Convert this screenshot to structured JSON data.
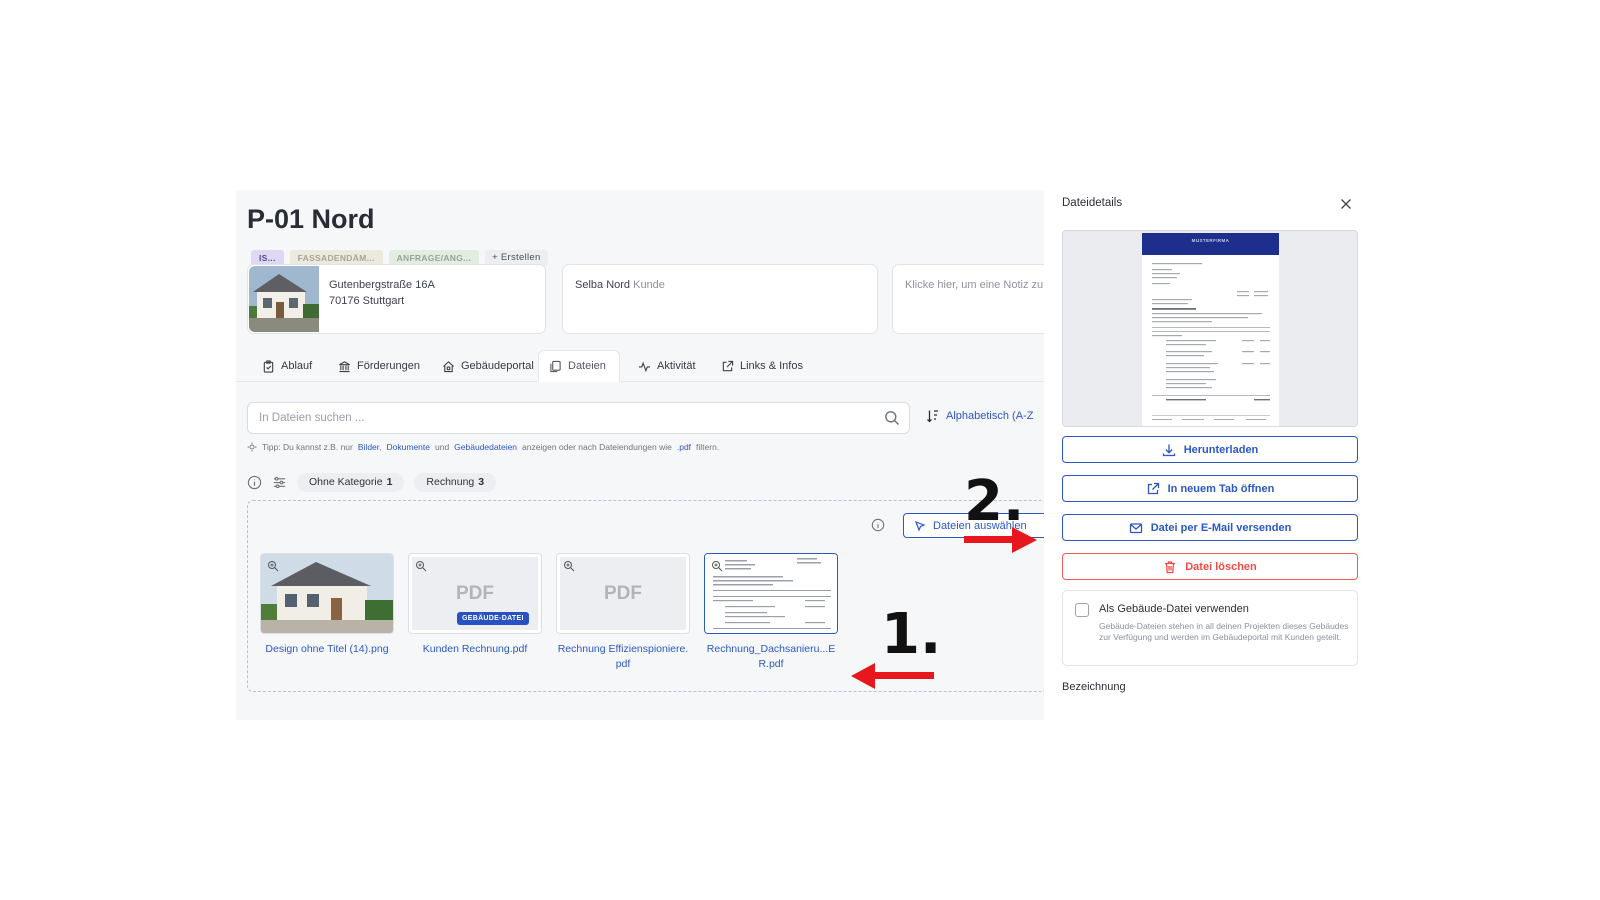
{
  "project": {
    "title": "P-01 Nord",
    "tags": [
      "IS...",
      "FASSADENDÄM...",
      "ANFRAGE/ANG...",
      "+ Erstellen"
    ],
    "address_line1": "Gutenbergstraße 16A",
    "address_line2": "70176 Stuttgart",
    "customer_name": "Selba Nord",
    "customer_role": "Kunde",
    "note_placeholder": "Klicke hier, um eine Notiz zu"
  },
  "tabs": [
    {
      "label": "Ablauf",
      "icon": "clipboard-icon"
    },
    {
      "label": "Förderungen",
      "icon": "bank-icon"
    },
    {
      "label": "Gebäudeportal",
      "icon": "house-icon"
    },
    {
      "label": "Dateien",
      "icon": "files-icon",
      "active": true
    },
    {
      "label": "Aktivität",
      "icon": "activity-icon"
    },
    {
      "label": "Links & Infos",
      "icon": "external-link-icon"
    }
  ],
  "search": {
    "placeholder": "In Dateien suchen ..."
  },
  "sort": {
    "label": "Alphabetisch (A-Z"
  },
  "tip": {
    "prefix": "Tipp: Du kannst z.B. nur",
    "link1": "Bilder",
    "sep1": ",",
    "link2": "Dokumente",
    "mid": "und",
    "link3": "Gebäudedateien",
    "middle": "anzeigen oder nach Dateiendungen wie",
    "link4": ".pdf",
    "suffix": "filtern."
  },
  "filters": [
    {
      "label": "Ohne Kategorie",
      "count": "1"
    },
    {
      "label": "Rechnung",
      "count": "3"
    }
  ],
  "dropzone": {
    "button_label": "Dateien auswählen"
  },
  "files": [
    {
      "name": "Design ohne Titel (14).png",
      "type": "image"
    },
    {
      "name": "Kunden Rechnung.pdf",
      "type": "pdf",
      "badge": "GEBÄUDE-DATEI",
      "pdf_text": "PDF"
    },
    {
      "name": "Rechnung Effizienspioniere.pdf",
      "type": "pdf",
      "pdf_text": "PDF"
    },
    {
      "name": "Rechnung_Dachsanieru...ER.pdf",
      "type": "document",
      "selected": true
    }
  ],
  "panel": {
    "title": "Dateidetails",
    "preview_header": "MUSTERFIRMA",
    "buttons": {
      "download": "Herunterladen",
      "open_tab": "In neuem Tab öffnen",
      "email": "Datei per E-Mail versenden",
      "delete": "Datei löschen"
    },
    "checkbox_label": "Als Gebäude-Datei verwenden",
    "checkbox_checked": false,
    "checkbox_desc": "Gebäude-Dateien stehen in all deinen Projekten dieses Gebäudes zur Verfügung und werden im Gebäudeportal mit Kunden geteilt.",
    "section_label": "Bezeichnung"
  },
  "annotations": {
    "step1": "1.",
    "step2": "2.",
    "arrow_color": "#e8171d"
  },
  "colors": {
    "accent": "#2b58c4",
    "danger": "#ef4b45",
    "badge": "#2852c2"
  }
}
